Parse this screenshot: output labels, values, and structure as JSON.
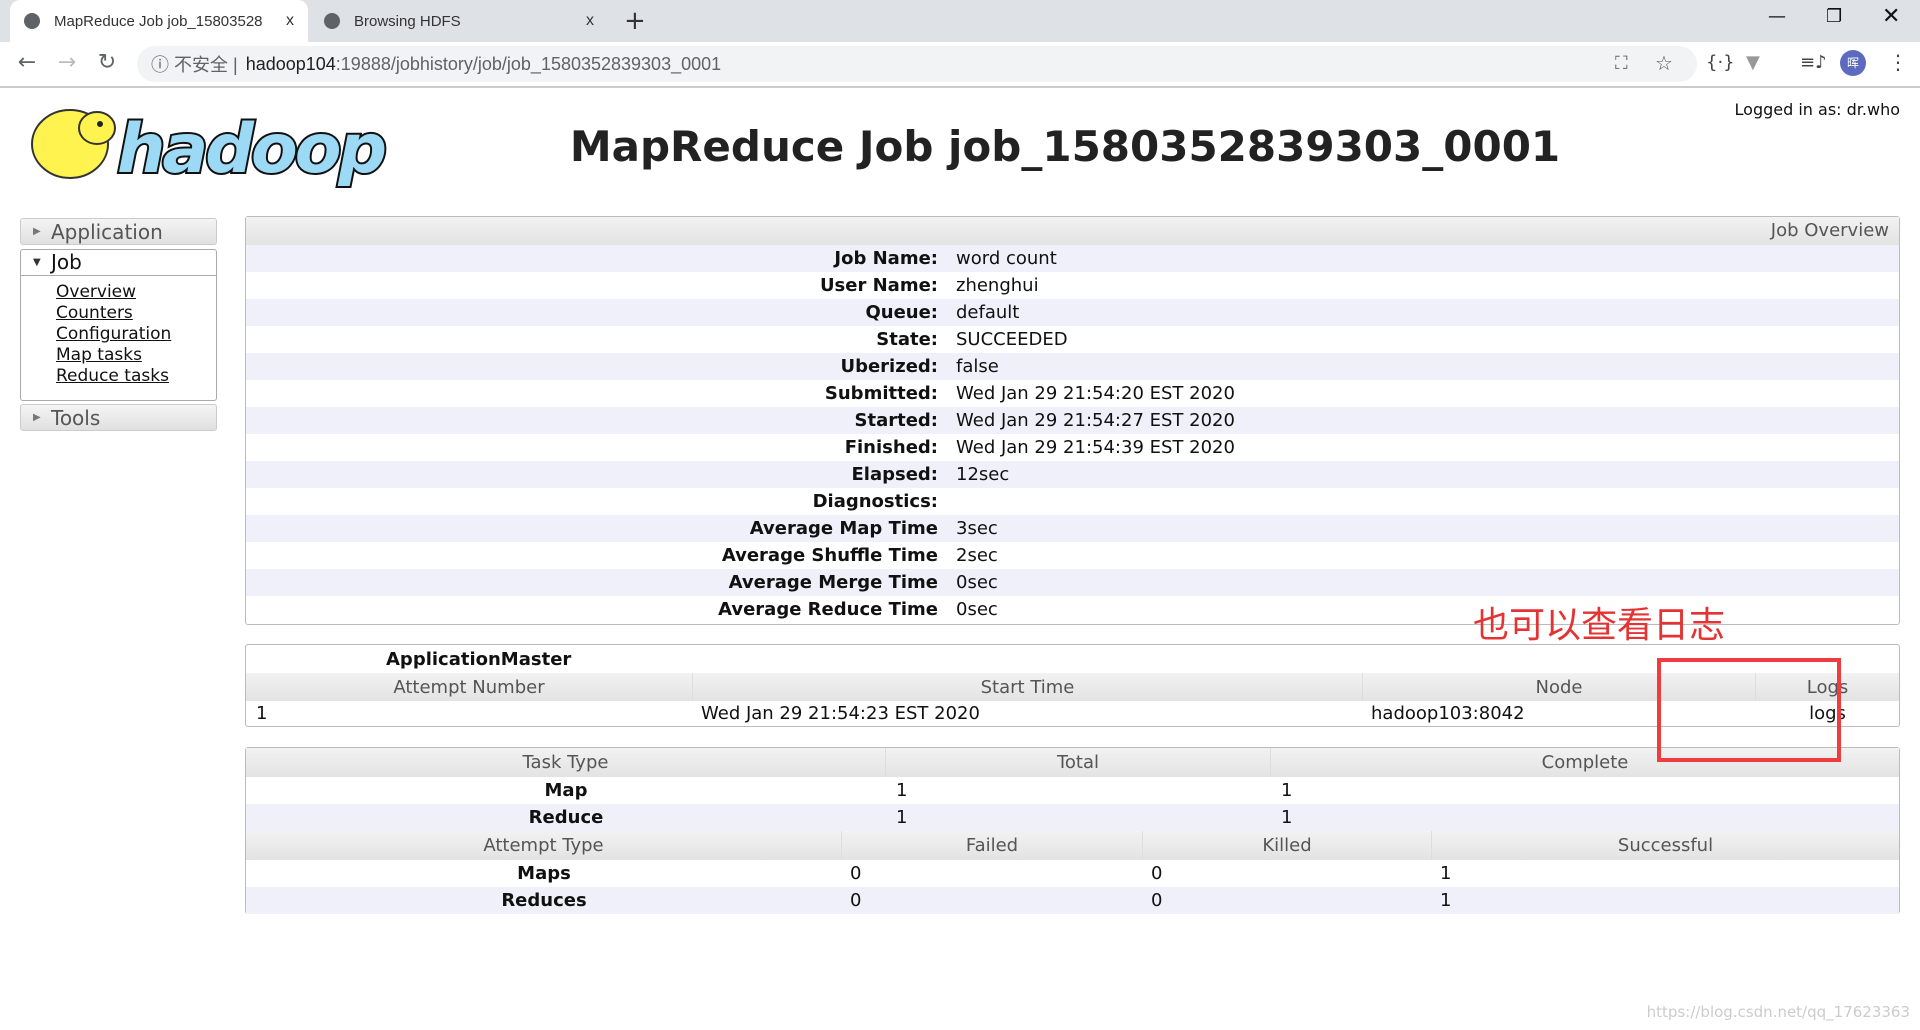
{
  "browser": {
    "tabs": [
      {
        "label": "MapReduce Job job_15803528",
        "close": "x"
      },
      {
        "label": "Browsing HDFS",
        "close": "x"
      }
    ],
    "new_tab": "+",
    "insecure": "ⓘ 不安全 |",
    "host": "hadoop104",
    "path": ":19888/jobhistory/job/job_1580352839303_0001",
    "avatar": "晖"
  },
  "header": {
    "title": "MapReduce Job job_1580352839303_0001",
    "logged_in": "Logged in as: dr.who"
  },
  "sidebar": {
    "application": "Application",
    "job": "Job",
    "links": [
      "Overview",
      "Counters",
      "Configuration",
      "Map tasks",
      "Reduce tasks"
    ],
    "tools": "Tools"
  },
  "overview": {
    "heading": "Job Overview",
    "rows": [
      {
        "k": "Job Name:",
        "v": "word count"
      },
      {
        "k": "User Name:",
        "v": "zhenghui"
      },
      {
        "k": "Queue:",
        "v": "default"
      },
      {
        "k": "State:",
        "v": "SUCCEEDED"
      },
      {
        "k": "Uberized:",
        "v": "false"
      },
      {
        "k": "Submitted:",
        "v": "Wed Jan 29 21:54:20 EST 2020"
      },
      {
        "k": "Started:",
        "v": "Wed Jan 29 21:54:27 EST 2020"
      },
      {
        "k": "Finished:",
        "v": "Wed Jan 29 21:54:39 EST 2020"
      },
      {
        "k": "Elapsed:",
        "v": "12sec"
      },
      {
        "k": "Diagnostics:",
        "v": ""
      },
      {
        "k": "Average Map Time",
        "v": "3sec"
      },
      {
        "k": "Average Shuffle Time",
        "v": "2sec"
      },
      {
        "k": "Average Merge Time",
        "v": "0sec"
      },
      {
        "k": "Average Reduce Time",
        "v": "0sec"
      }
    ]
  },
  "am": {
    "title": "ApplicationMaster",
    "headers": [
      "Attempt Number",
      "Start Time",
      "Node",
      "Logs"
    ],
    "row": [
      "1",
      "Wed Jan 29 21:54:23 EST 2020",
      "hadoop103:8042",
      "logs"
    ]
  },
  "tasks": {
    "headers": [
      "Task Type",
      "Total",
      "Complete"
    ],
    "rows": [
      [
        "Map",
        "1",
        "1"
      ],
      [
        "Reduce",
        "1",
        "1"
      ]
    ]
  },
  "attempts": {
    "headers": [
      "Attempt Type",
      "Failed",
      "Killed",
      "Successful"
    ],
    "rows": [
      [
        "Maps",
        "0",
        "0",
        "1"
      ],
      [
        "Reduces",
        "0",
        "0",
        "1"
      ]
    ]
  },
  "annotation": "也可以查看日志",
  "watermark": "https://blog.csdn.net/qq_17623363"
}
